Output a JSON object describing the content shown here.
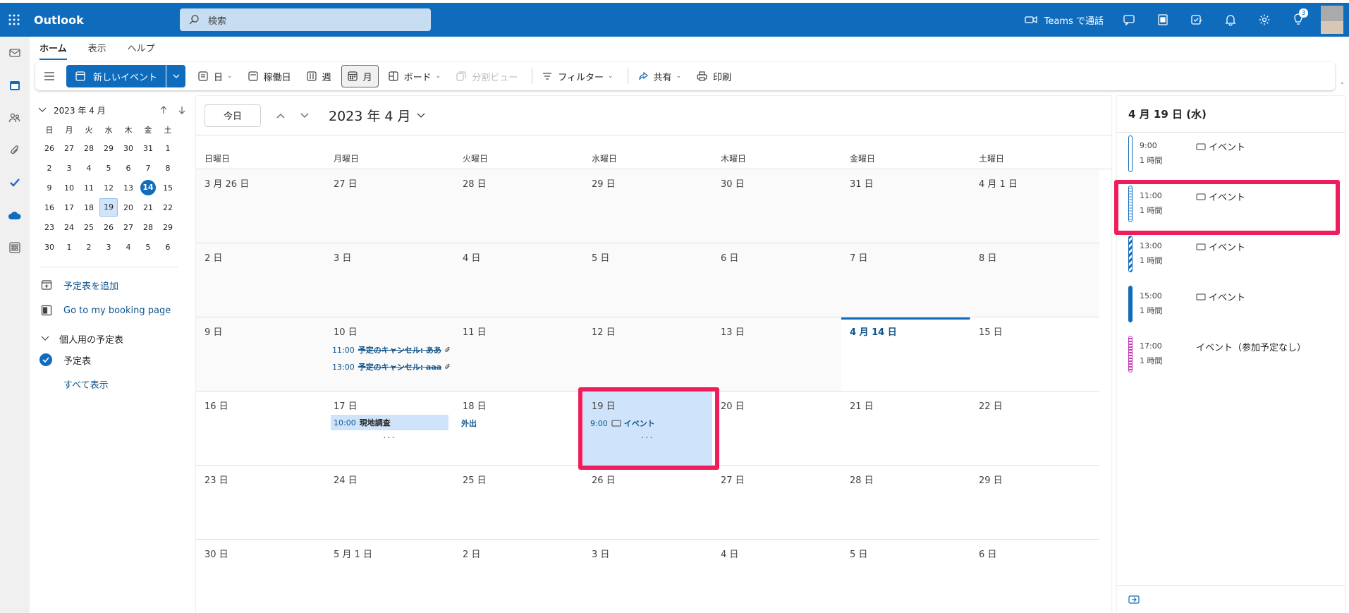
{
  "app": {
    "title": "Outlook"
  },
  "search": {
    "placeholder": "検索"
  },
  "topbar": {
    "teams_call": "Teams で通話",
    "notif_count": "3"
  },
  "ribbon": {
    "tabs": [
      "ホーム",
      "表示",
      "ヘルプ"
    ],
    "new_event": "新しいイベント",
    "views": {
      "day": "日",
      "workweek": "稼働日",
      "week": "週",
      "month": "月",
      "board": "ボード",
      "split": "分割ビュー"
    },
    "filter": "フィルター",
    "share": "共有",
    "print": "印刷"
  },
  "minical": {
    "title": "2023 年 4 月",
    "dow": [
      "日",
      "月",
      "火",
      "水",
      "木",
      "金",
      "土"
    ],
    "weeks": [
      [
        "26",
        "27",
        "28",
        "29",
        "30",
        "31",
        "1"
      ],
      [
        "2",
        "3",
        "4",
        "5",
        "6",
        "7",
        "8"
      ],
      [
        "9",
        "10",
        "11",
        "12",
        "13",
        "14",
        "15"
      ],
      [
        "16",
        "17",
        "18",
        "19",
        "20",
        "21",
        "22"
      ],
      [
        "23",
        "24",
        "25",
        "26",
        "27",
        "28",
        "29"
      ],
      [
        "30",
        "1",
        "2",
        "3",
        "4",
        "5",
        "6"
      ]
    ]
  },
  "leftpane": {
    "add_calendar": "予定表を追加",
    "booking": "Go to my booking page",
    "group": "個人用の予定表",
    "calendar": "予定表",
    "show_all": "すべて表示"
  },
  "month": {
    "today": "今日",
    "title": "2023 年 4 月",
    "dow": [
      "日曜日",
      "月曜日",
      "火曜日",
      "水曜日",
      "木曜日",
      "金曜日",
      "土曜日"
    ],
    "weeks": [
      [
        "3 月 26 日",
        "27 日",
        "28 日",
        "29 日",
        "30 日",
        "31 日",
        "4 月 1 日"
      ],
      [
        "2 日",
        "3 日",
        "4 日",
        "5 日",
        "6 日",
        "7 日",
        "8 日"
      ],
      [
        "9 日",
        "10 日",
        "11 日",
        "12 日",
        "13 日",
        "4 月 14 日",
        "15 日"
      ],
      [
        "16 日",
        "17 日",
        "18 日",
        "19 日",
        "20 日",
        "21 日",
        "22 日"
      ],
      [
        "23 日",
        "24 日",
        "25 日",
        "26 日",
        "27 日",
        "28 日",
        "29 日"
      ],
      [
        "30 日",
        "5 月 1 日",
        "2 日",
        "3 日",
        "4 日",
        "5 日",
        "6 日"
      ]
    ],
    "events": {
      "apr10_1_time": "11:00",
      "apr10_1_title": "予定のキャンセル: ああ",
      "apr10_2_time": "13:00",
      "apr10_2_title": "予定のキャンセル: aaa",
      "apr17_time": "10:00",
      "apr17_title": "現地調査",
      "apr18_title": "外出",
      "apr19_time": "9:00",
      "apr19_title": "イベント",
      "more": "···"
    }
  },
  "agenda": {
    "date": "4 月 19 日 (水)",
    "items": [
      {
        "time": "9:00",
        "duration": "1 時間",
        "title": "イベント"
      },
      {
        "time": "11:00",
        "duration": "1 時間",
        "title": "イベント"
      },
      {
        "time": "13:00",
        "duration": "1 時間",
        "title": "イベント"
      },
      {
        "time": "15:00",
        "duration": "1 時間",
        "title": "イベント"
      },
      {
        "time": "17:00",
        "duration": "1 時間",
        "title": "イベント（参加予定なし）"
      }
    ]
  },
  "colors": {
    "brand": "#0f6cbd",
    "highlight": "#f01d5d"
  }
}
